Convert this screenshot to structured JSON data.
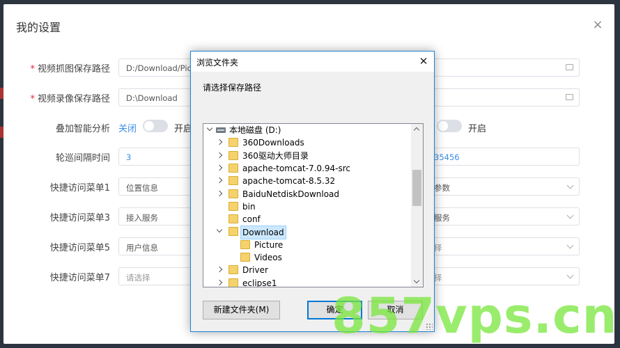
{
  "settings": {
    "title": "我的设置",
    "close_glyph": "×",
    "rows": [
      {
        "label": "视频抓图保存路径",
        "required": "*",
        "left_value": "D:/Download/Pictur"
      },
      {
        "label": "视频录像保存路径",
        "required": "*",
        "left_value": "D:\\Download"
      },
      {
        "label": "叠加智能分析",
        "switch_off": "关闭",
        "switch_on": "开启",
        "right_switch_on": "开启"
      },
      {
        "label": "轮巡间隔时间",
        "left_value": "3",
        "right_value": "35456"
      },
      {
        "label": "快捷访问菜单1",
        "left_value": "位置信息",
        "right_value": "参数"
      },
      {
        "label": "快捷访问菜单3",
        "left_value": "接入服务",
        "right_value": "服务"
      },
      {
        "label": "快捷访问菜单5",
        "left_value": "用户信息",
        "right_value": "择"
      },
      {
        "label": "快捷访问菜单7",
        "left_placeholder": "请选择",
        "right_value": "择"
      }
    ]
  },
  "dialog": {
    "title": "浏览文件夹",
    "close_glyph": "✕",
    "prompt": "请选择保存路径",
    "tree": [
      {
        "label": "本地磁盘 (D:)",
        "level": 0,
        "state": "expanded",
        "kind": "drive"
      },
      {
        "label": "360Downloads",
        "level": 1,
        "state": "collapsed",
        "kind": "folder"
      },
      {
        "label": "360驱动大师目录",
        "level": 1,
        "state": "collapsed",
        "kind": "folder"
      },
      {
        "label": "apache-tomcat-7.0.94-src",
        "level": 1,
        "state": "collapsed",
        "kind": "folder"
      },
      {
        "label": "apache-tomcat-8.5.32",
        "level": 1,
        "state": "collapsed",
        "kind": "folder"
      },
      {
        "label": "BaiduNetdiskDownload",
        "level": 1,
        "state": "collapsed",
        "kind": "folder"
      },
      {
        "label": "bin",
        "level": 1,
        "state": "none",
        "kind": "folder"
      },
      {
        "label": "conf",
        "level": 1,
        "state": "none",
        "kind": "folder"
      },
      {
        "label": "Download",
        "level": 1,
        "state": "expanded",
        "kind": "folder",
        "selected": true
      },
      {
        "label": "Picture",
        "level": 2,
        "state": "none",
        "kind": "folder"
      },
      {
        "label": "Videos",
        "level": 2,
        "state": "none",
        "kind": "folder"
      },
      {
        "label": "Driver",
        "level": 1,
        "state": "collapsed",
        "kind": "folder"
      },
      {
        "label": "eclipse1",
        "level": 1,
        "state": "collapsed",
        "kind": "folder"
      }
    ],
    "new_folder_label": "新建文件夹(M)",
    "ok_label": "确定",
    "cancel_label": "取消"
  },
  "watermark": "857vps.cn"
}
